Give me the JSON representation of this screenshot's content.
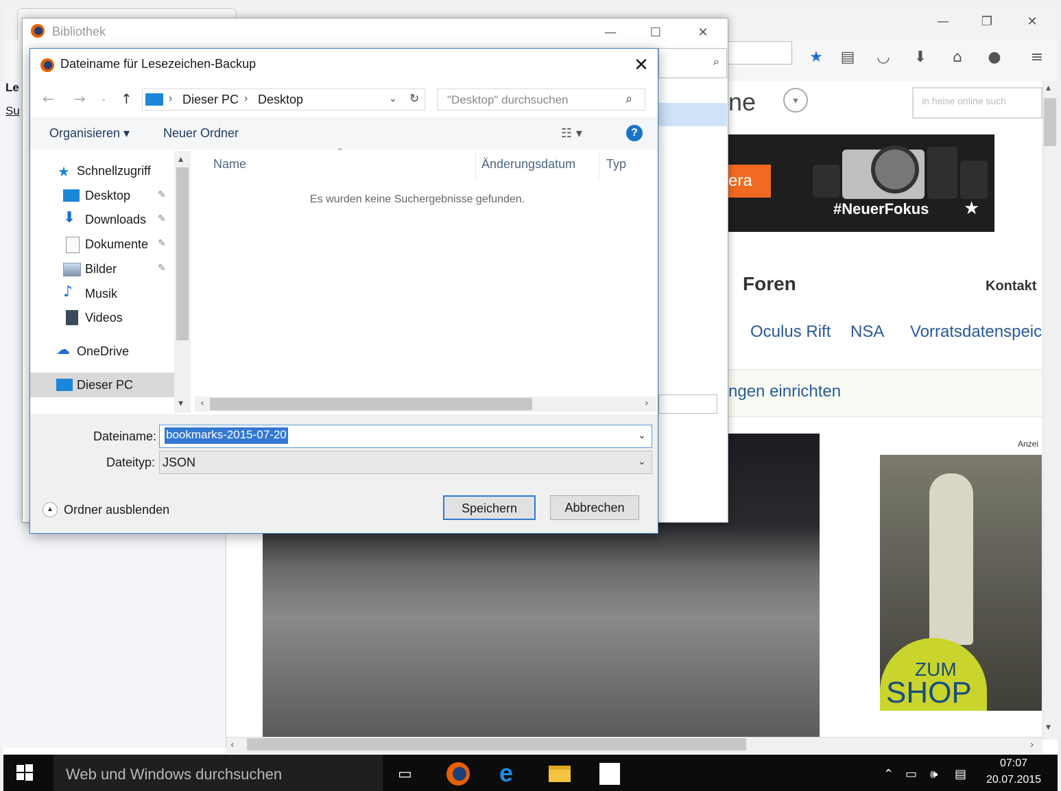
{
  "browser": {
    "toolbar_icons": [
      "star-icon",
      "reading-list-icon",
      "pocket-icon",
      "download-icon",
      "home-icon",
      "chat-icon",
      "menu-icon"
    ],
    "search_placeholder": "in heise online such",
    "left_text_1": "Le",
    "left_text_2": "Su"
  },
  "website": {
    "logo_text": "ne",
    "banner_orange_text": "era",
    "banner_hashtag": "#NeuerFokus",
    "banner_star": "★",
    "nav_foren": "Foren",
    "nav_kontakt": "Kontakt",
    "topics": [
      "Oculus Rift",
      "NSA",
      "Vorratsdatenspeic"
    ],
    "notice": "ngen einrichten",
    "ad_label": "Anzei",
    "ad_zum": "ZUM",
    "ad_shop": "SHOP"
  },
  "library": {
    "title": "Bibliothek"
  },
  "dialog": {
    "title": "Dateiname für Lesezeichen-Backup",
    "close": "✕",
    "breadcrumb": [
      "Dieser PC",
      "Desktop"
    ],
    "search_placeholder": "\"Desktop\" durchsuchen",
    "organize_label": "Organisieren ▾",
    "new_folder_label": "Neuer Ordner",
    "help": "?",
    "nav_items": [
      {
        "label": "Schnellzugriff",
        "icon": "star-icon",
        "pinned": false
      },
      {
        "label": "Desktop",
        "icon": "desktop-icon",
        "pinned": true
      },
      {
        "label": "Downloads",
        "icon": "download-arrow-icon",
        "pinned": true
      },
      {
        "label": "Dokumente",
        "icon": "document-icon",
        "pinned": true
      },
      {
        "label": "Bilder",
        "icon": "pictures-icon",
        "pinned": true
      },
      {
        "label": "Musik",
        "icon": "music-icon",
        "pinned": false
      },
      {
        "label": "Videos",
        "icon": "video-icon",
        "pinned": false
      },
      {
        "label": "OneDrive",
        "icon": "cloud-icon",
        "pinned": false
      },
      {
        "label": "Dieser PC",
        "icon": "computer-icon",
        "pinned": false
      }
    ],
    "columns": [
      "Name",
      "Änderungsdatum",
      "Typ"
    ],
    "empty_message": "Es wurden keine Suchergebnisse gefunden.",
    "filename_label": "Dateiname:",
    "filename_value": "bookmarks-2015-07-20",
    "filetype_label": "Dateityp:",
    "filetype_value": "JSON",
    "hide_folders_label": "Ordner ausblenden",
    "save_label": "Speichern",
    "cancel_label": "Abbrechen"
  },
  "taskbar": {
    "search_placeholder": "Web und Windows durchsuchen",
    "time": "07:07",
    "date": "20.07.2015"
  },
  "colors": {
    "accent": "#3478d4",
    "banner_orange": "#f26a21",
    "link_blue": "#2b5a9b",
    "ad_yellow": "#c9d42c"
  }
}
